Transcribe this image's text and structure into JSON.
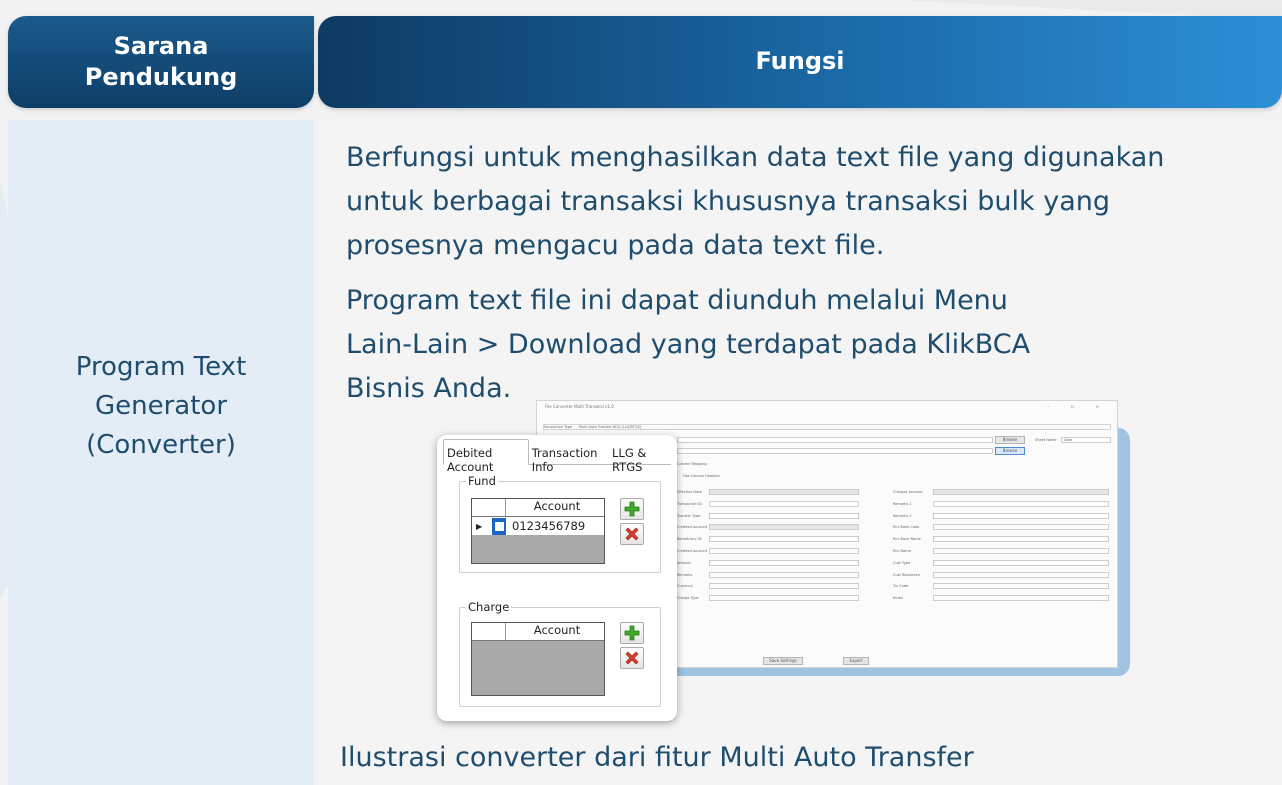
{
  "header": {
    "left_title": "Sarana\nPendukung",
    "right_title": "Fungsi"
  },
  "row": {
    "tool_name": "Program Text\nGenerator\n(Converter)",
    "paragraph1": "Berfungsi untuk menghasilkan data text file yang digunakan untuk berbagai transaksi khususnya transaksi bulk yang prosesnya mengacu pada data text file.",
    "paragraph2": "Program text file ini dapat diunduh melalui Menu Lain-Lain > Download yang terdapat pada KlikBCA Bisnis Anda.",
    "caption": "Ilustrasi converter dari fitur Multi Auto Transfer"
  },
  "app_window": {
    "title": "File Converter Multi Transaksi v1.0",
    "window_controls": "–  ☐  ✕",
    "transaction_type_label": "Transaction Type",
    "transaction_type_value": "Multi Auto Transfer BCA (LLG/RTGS)",
    "browse_label": "Browse",
    "sheet_name_label": "Sheet Name",
    "sheet_name_value": "Data",
    "column_mapping_label": "Column Mapping",
    "has_column_headers_label": "Has Column Headers",
    "save_settings_label": "Save Settings",
    "export_label": "Export",
    "left_field_labels": [
      "Effective Date",
      "Transaction ID",
      "Transfer Type",
      "Credited Account",
      "Beneficiary ID",
      "Credited Account",
      "Amount",
      "Remarks",
      "Currency",
      "Charge Type"
    ],
    "right_field_labels": [
      "Charges Account",
      "Remarks 1",
      "Remarks 2",
      "Rcv Bank Code",
      "Rcv Bank Name",
      "Rcv Name",
      "Cust Type",
      "Cust Residence",
      "Trx Code",
      "Email"
    ]
  },
  "popup": {
    "tabs": [
      "Debited Account",
      "Transaction Info",
      "LLG & RTGS"
    ],
    "fund_group_title": "Fund",
    "charge_group_title": "Charge",
    "account_column_header": "Account",
    "fund_account_value": "0123456789",
    "add_icon": "green-plus-icon",
    "remove_icon": "red-x-icon"
  },
  "colors": {
    "header_dark": "#0e3e66",
    "header_light": "#2d8fd6",
    "text": "#1f4d6e",
    "left_col_bg": "#e4edf5"
  }
}
